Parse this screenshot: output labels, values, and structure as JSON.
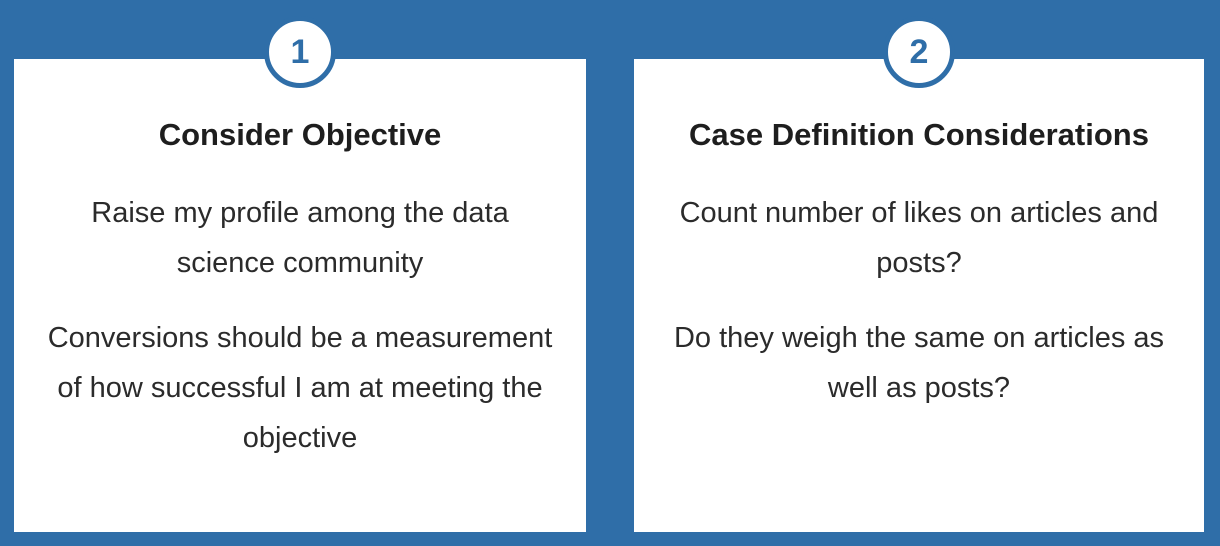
{
  "cards": [
    {
      "number": "1",
      "title": "Consider Objective",
      "paragraphs": [
        "Raise my profile among the data science community",
        "Conversions should be a measurement of how successful I am at meeting the objective"
      ]
    },
    {
      "number": "2",
      "title": "Case Definition Considerations",
      "paragraphs": [
        "Count number of likes on articles and posts?",
        "Do they weigh the same on articles as well as posts?"
      ]
    }
  ],
  "colors": {
    "background": "#2f6ea8",
    "card": "#ffffff",
    "badge_border": "#2f6ea8",
    "text": "#222222"
  }
}
